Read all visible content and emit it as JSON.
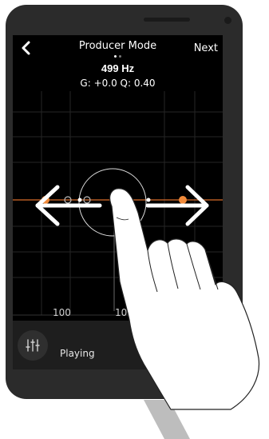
{
  "header": {
    "title": "Producer Mode",
    "next_label": "Next",
    "page_count": 2,
    "current_page": 1
  },
  "readout": {
    "frequency": "499 Hz",
    "params": "G: +0.0  Q: 0.40"
  },
  "graph": {
    "axis_labels": [
      "100",
      "10"
    ]
  },
  "bottom_bar": {
    "status": "Playing"
  },
  "colors": {
    "accent": "#f08a3a",
    "screen_bg": "#000000",
    "phone_body": "#2b2b2b",
    "text": "#ffffff"
  },
  "icons": {
    "back": "chevron-left-icon",
    "equalizer": "sliders-icon",
    "swipe_left": "arrow-left-icon",
    "swipe_right": "arrow-right-icon"
  }
}
